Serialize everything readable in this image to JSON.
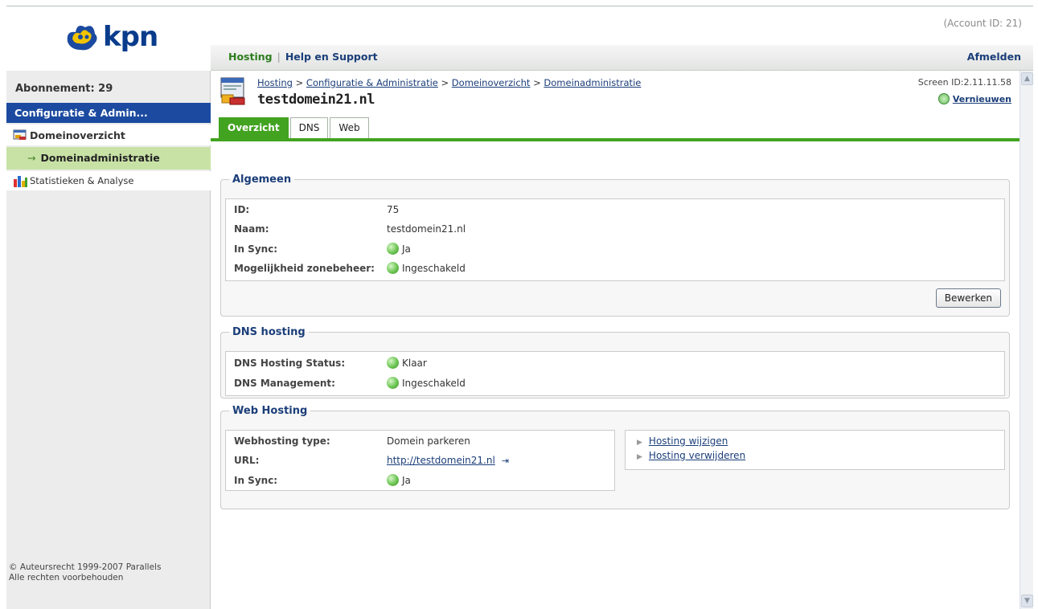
{
  "header": {
    "logo_text": "kpn",
    "account": "(Account ID: 21)",
    "nav": {
      "hosting": "Hosting",
      "separator": "|",
      "help": "Help en Support",
      "logout": "Afmelden"
    }
  },
  "sidebar": {
    "subscription": "Abonnement: 29",
    "section": "Configuratie & Admin...",
    "items": [
      {
        "label": "Domeinoverzicht",
        "icon": "domain-icon"
      },
      {
        "label": "Domeinadministratie",
        "arrow": "→"
      },
      {
        "label": "Statistieken & Analyse",
        "icon": "stats-icon"
      }
    ],
    "copyright_line1": "© Auteursrecht 1999-2007 Parallels",
    "copyright_line2": "Alle rechten voorbehouden"
  },
  "page": {
    "breadcrumb": {
      "c1": "Hosting",
      "sep": " > ",
      "c2": "Configuratie & Administratie",
      "c3": "Domeinoverzicht",
      "c4": "Domeinadministratie"
    },
    "title": "testdomein21.nl",
    "screen_id": "Screen ID:2.11.11.58",
    "refresh": "Vernieuwen",
    "tabs": [
      "Overzicht",
      "DNS",
      "Web"
    ]
  },
  "algemeen": {
    "legend": "Algemeen",
    "rows": [
      {
        "label": "ID:",
        "value": "75"
      },
      {
        "label": "Naam:",
        "value": "testdomein21.nl"
      },
      {
        "label": "In Sync:",
        "value": "Ja"
      },
      {
        "label": "Mogelijkheid zonebeheer:",
        "value": "Ingeschakeld"
      }
    ],
    "edit_button": "Bewerken"
  },
  "dns": {
    "legend": "DNS hosting",
    "rows": [
      {
        "label": "DNS Hosting Status:",
        "value": "Klaar"
      },
      {
        "label": "DNS Management:",
        "value": "Ingeschakeld"
      }
    ]
  },
  "web": {
    "legend": "Web Hosting",
    "rows": [
      {
        "label": "Webhosting type:",
        "value": "Domein parkeren"
      },
      {
        "label": "URL:",
        "value": "http://testdomein21.nl"
      },
      {
        "label": "In Sync:",
        "value": "Ja"
      }
    ],
    "actions": [
      "Hosting wijzigen",
      "Hosting verwijderen"
    ]
  },
  "colors": {
    "green": "#42a320",
    "blue": "#1b4aa0",
    "link": "#1b3e79"
  }
}
